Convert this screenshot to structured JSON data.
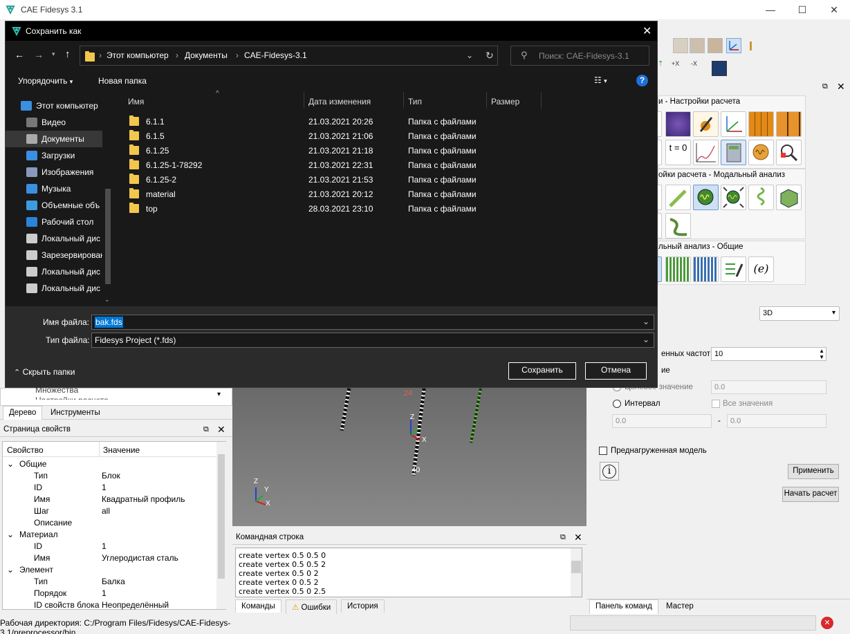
{
  "app": {
    "title": "CAE Fidesys 3.1",
    "window_buttons": [
      "—",
      "☐",
      "✕"
    ]
  },
  "right_panel": {
    "group1_title": "и - Настройки расчета",
    "group2_title": "ойки расчета - Модальный анализ",
    "group3_title": "льный анализ - Общие",
    "t0_label": "t = 0",
    "paren_e_label": "(e)",
    "dimension_select": "3D",
    "freq_label": "енных частот",
    "freq_value": "10",
    "partial_label": "ие",
    "target_label": "Целевое значение",
    "target_value": "0.0",
    "interval_label": "Интервал",
    "all_values_label": "Все значения",
    "interval_from": "0.0",
    "interval_dash": "-",
    "interval_to": "0.0",
    "preloaded_label": "Преднагруженная модель",
    "info_label": "i",
    "apply_button": "Применить",
    "start_button": "Начать расчет",
    "tabs": [
      "Панель команд",
      "Мастер"
    ]
  },
  "left_panel": {
    "tree_partial_1": "Множества",
    "tree_partial_2": "Настройки расчета",
    "tabs": [
      "Дерево",
      "Инструменты"
    ],
    "props_title": "Страница свойств",
    "props_headers": [
      "Свойство",
      "Значение"
    ],
    "props": [
      {
        "type": "group",
        "name": "Общие"
      },
      {
        "type": "row",
        "name": "Тип",
        "value": "Блок"
      },
      {
        "type": "row",
        "name": "ID",
        "value": "1"
      },
      {
        "type": "row",
        "name": "Имя",
        "value": "Квадратный профиль"
      },
      {
        "type": "row",
        "name": "Шаг",
        "value": "all"
      },
      {
        "type": "row",
        "name": "Описание",
        "value": ""
      },
      {
        "type": "group",
        "name": "Материал"
      },
      {
        "type": "row",
        "name": "ID",
        "value": "1"
      },
      {
        "type": "row",
        "name": "Имя",
        "value": "Углеродистая сталь"
      },
      {
        "type": "group",
        "name": "Элемент"
      },
      {
        "type": "row",
        "name": "Тип",
        "value": "Балка"
      },
      {
        "type": "row",
        "name": "Порядок",
        "value": "1"
      },
      {
        "type": "row",
        "name": "ID свойств блока",
        "value": "Неопределённый"
      }
    ]
  },
  "viewport": {
    "labels": [
      "24",
      "40",
      "Z",
      "X",
      "Z",
      "Y",
      "X"
    ]
  },
  "command_line": {
    "title": "Командная строка",
    "lines": [
      "create vertex 0.5 0.5 0",
      "create vertex 0.5 0.5 2",
      "create vertex 0.5 0 2",
      "create vertex 0 0.5 2",
      "create vertex 0.5 0 2.5"
    ],
    "tabs": [
      "Команды",
      "Ошибки",
      "История"
    ]
  },
  "status_bar": {
    "text": "Рабочая директория: C:/Program Files/Fidesys/CAE-Fidesys-3.1/preprocessor/bin"
  },
  "dialog": {
    "title": "Сохранить как",
    "breadcrumb": [
      "Этот компьютер",
      "Документы",
      "CAE-Fidesys-3.1"
    ],
    "search_placeholder": "Поиск: CAE-Fidesys-3.1",
    "organize_label": "Упорядочить",
    "new_folder_label": "Новая папка",
    "nav_items": [
      {
        "label": "Этот компьютер",
        "icon": "computer-icon"
      },
      {
        "label": "Видео",
        "icon": "video-icon"
      },
      {
        "label": "Документы",
        "icon": "documents-icon"
      },
      {
        "label": "Загрузки",
        "icon": "downloads-icon"
      },
      {
        "label": "Изображения",
        "icon": "pictures-icon"
      },
      {
        "label": "Музыка",
        "icon": "music-icon"
      },
      {
        "label": "Объемные объ",
        "icon": "3d-objects-icon"
      },
      {
        "label": "Рабочий стол",
        "icon": "desktop-icon"
      },
      {
        "label": "Локальный дис",
        "icon": "drive-icon"
      },
      {
        "label": "Зарезервирован",
        "icon": "drive-icon"
      },
      {
        "label": "Локальный дис",
        "icon": "drive-icon"
      },
      {
        "label": "Локальный дис",
        "icon": "drive-icon"
      }
    ],
    "columns": [
      "Имя",
      "Дата изменения",
      "Тип",
      "Размер"
    ],
    "files": [
      {
        "name": "6.1.1",
        "date": "21.03.2021 20:26",
        "type": "Папка с файлами",
        "size": ""
      },
      {
        "name": "6.1.5",
        "date": "21.03.2021 21:06",
        "type": "Папка с файлами",
        "size": ""
      },
      {
        "name": "6.1.25",
        "date": "21.03.2021 21:18",
        "type": "Папка с файлами",
        "size": ""
      },
      {
        "name": "6.1.25-1-78292",
        "date": "21.03.2021 22:31",
        "type": "Папка с файлами",
        "size": ""
      },
      {
        "name": "6.1.25-2",
        "date": "21.03.2021 21:53",
        "type": "Папка с файлами",
        "size": ""
      },
      {
        "name": "material",
        "date": "21.03.2021 20:12",
        "type": "Папка с файлами",
        "size": ""
      },
      {
        "name": "top",
        "date": "28.03.2021 23:10",
        "type": "Папка с файлами",
        "size": ""
      }
    ],
    "filename_label": "Имя файла:",
    "filename_value": "bak.fds",
    "filetype_label": "Тип файла:",
    "filetype_value": "Fidesys Project (*.fds)",
    "hide_folders_label": "Скрыть папки",
    "save_button": "Сохранить",
    "cancel_button": "Отмена",
    "help_label": "?"
  }
}
